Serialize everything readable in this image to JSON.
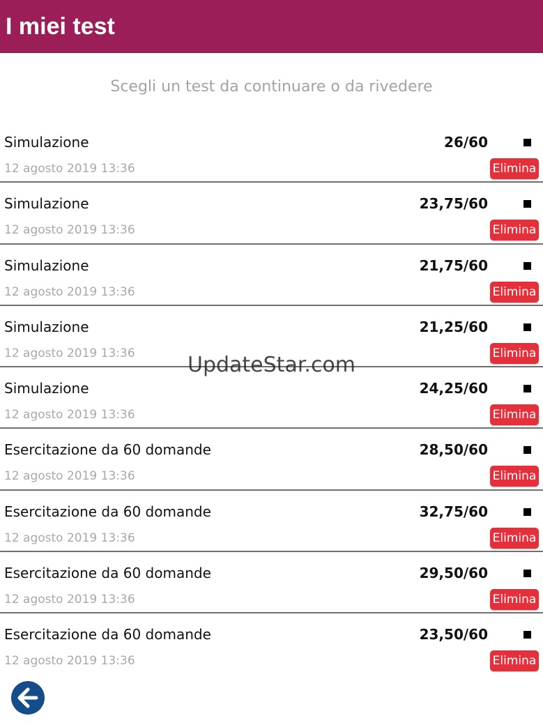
{
  "header": {
    "title": "I miei test"
  },
  "subtitle": "Scegli un test da continuare o da rivedere",
  "tests": [
    {
      "title": "Simulazione",
      "score": "26/60",
      "date": "12 agosto 2019 13:36",
      "delete_label": "Elimina"
    },
    {
      "title": "Simulazione",
      "score": "23,75/60",
      "date": "12 agosto 2019 13:36",
      "delete_label": "Elimina"
    },
    {
      "title": "Simulazione",
      "score": "21,75/60",
      "date": "12 agosto 2019 13:36",
      "delete_label": "Elimina"
    },
    {
      "title": "Simulazione",
      "score": "21,25/60",
      "date": "12 agosto 2019 13:36",
      "delete_label": "Elimina"
    },
    {
      "title": "Simulazione",
      "score": "24,25/60",
      "date": "12 agosto 2019 13:36",
      "delete_label": "Elimina"
    },
    {
      "title": "Esercitazione da 60 domande",
      "score": "28,50/60",
      "date": "12 agosto 2019 13:36",
      "delete_label": "Elimina"
    },
    {
      "title": "Esercitazione da 60 domande",
      "score": "32,75/60",
      "date": "12 agosto 2019 13:36",
      "delete_label": "Elimina"
    },
    {
      "title": "Esercitazione da 60 domande",
      "score": "29,50/60",
      "date": "12 agosto 2019 13:36",
      "delete_label": "Elimina"
    },
    {
      "title": "Esercitazione da 60 domande",
      "score": "23,50/60",
      "date": "12 agosto 2019 13:36",
      "delete_label": "Elimina"
    }
  ],
  "watermark": "UpdateStar.com",
  "icons": {
    "back": "arrow-left-icon",
    "status": "square-icon"
  },
  "colors": {
    "header": "#9c1e59",
    "delete": "#e5303c",
    "back": "#154c8a"
  }
}
